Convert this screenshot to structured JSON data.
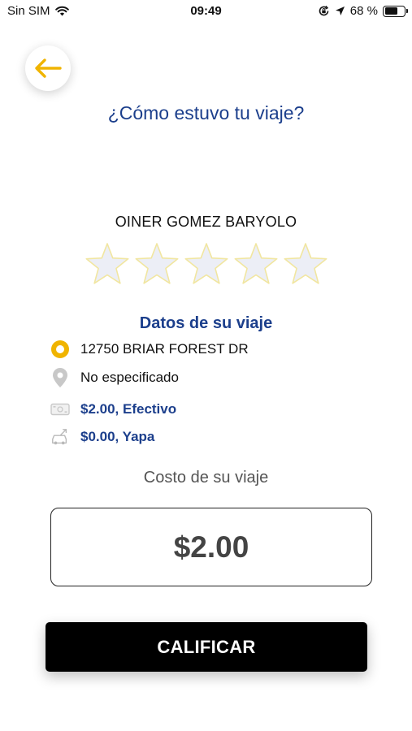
{
  "status_bar": {
    "carrier": "Sin SIM",
    "time": "09:49",
    "battery_percent": "68 %",
    "battery_level": 0.68
  },
  "header": {
    "back_icon": "arrow-left-icon",
    "title": "¿Cómo estuvo tu viaje?"
  },
  "driver": {
    "name": "OINER GOMEZ BARYOLO"
  },
  "rating": {
    "max_stars": 5,
    "selected": 0,
    "star_fill": "#eceef6",
    "star_stroke": "#f1e6a0"
  },
  "trip": {
    "section_title": "Datos de su viaje",
    "origin": "12750 BRIAR FOREST DR",
    "destination": "No especificado",
    "fare": "$2.00, Efectivo",
    "tip": "$0.00, Yapa"
  },
  "cost": {
    "label": "Costo de su viaje",
    "amount": "$2.00"
  },
  "actions": {
    "rate_label": "CALIFICAR"
  },
  "colors": {
    "accent": "#f0b400",
    "title_blue": "#1c3f8c",
    "button_bg": "#000000"
  }
}
